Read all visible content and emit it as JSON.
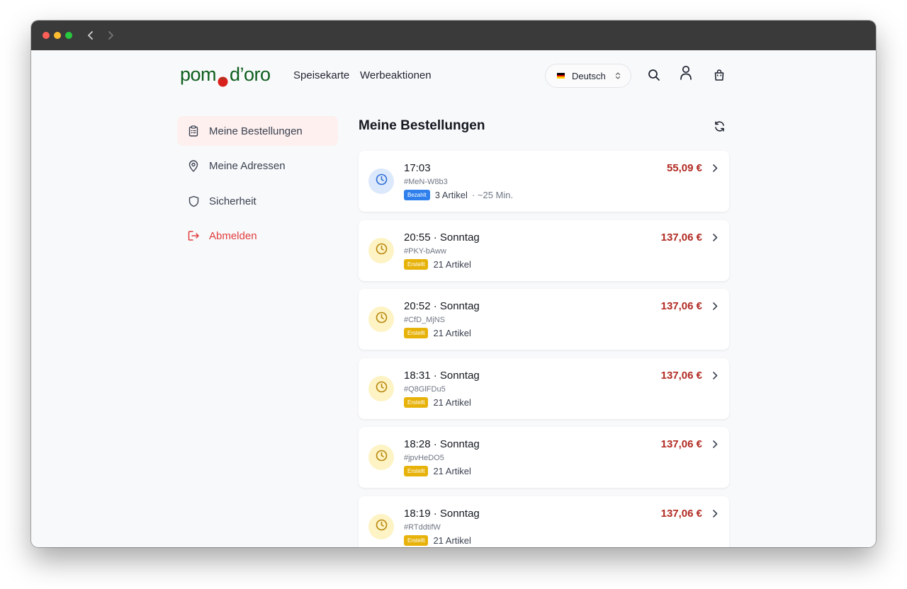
{
  "header": {
    "logo": {
      "prefix": "pom",
      "suffix": "d’oro"
    },
    "nav": [
      "Speisekarte",
      "Werbeaktionen"
    ],
    "language": "Deutsch"
  },
  "sidebar": {
    "items": [
      {
        "label": "Meine Bestellungen",
        "icon": "clipboard-icon",
        "active": true
      },
      {
        "label": "Meine Adressen",
        "icon": "map-pin-icon"
      },
      {
        "label": "Sicherheit",
        "icon": "shield-icon"
      },
      {
        "label": "Abmelden",
        "icon": "logout-icon"
      }
    ]
  },
  "main": {
    "title": "Meine Bestellungen",
    "orders": [
      {
        "time": "17:03",
        "id": "#MeN-W8b3",
        "status": "Bezahlt",
        "items": "3 Artikel",
        "extra": "· ~25 Min.",
        "price": "55,09 €"
      },
      {
        "time": "20:55 · Sonntag",
        "id": "#PKY-bAww",
        "status": "Erstellt",
        "items": "21 Artikel",
        "price": "137,06 €"
      },
      {
        "time": "20:52 · Sonntag",
        "id": "#CfD_MjNS",
        "status": "Erstellt",
        "items": "21 Artikel",
        "price": "137,06 €"
      },
      {
        "time": "18:31 · Sonntag",
        "id": "#Q8GlFDu5",
        "status": "Erstellt",
        "items": "21 Artikel",
        "price": "137,06 €"
      },
      {
        "time": "18:28 · Sonntag",
        "id": "#jpvHeDO5",
        "status": "Erstellt",
        "items": "21 Artikel",
        "price": "137,06 €"
      },
      {
        "time": "18:19 · Sonntag",
        "id": "#RTddtifW",
        "status": "Erstellt",
        "items": "21 Artikel",
        "price": "137,06 €"
      }
    ]
  },
  "colors": {
    "brand": "#0f5f1e",
    "accent": "#e23c3c",
    "price": "#b22a22",
    "paid": "#2f80ed",
    "created": "#e7b20a"
  }
}
